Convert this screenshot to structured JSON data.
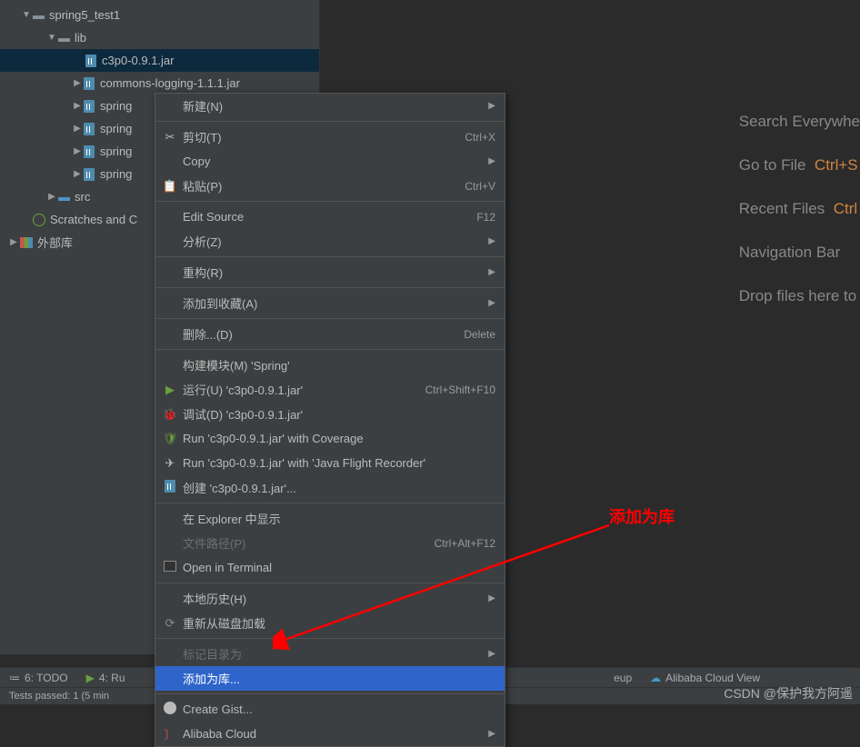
{
  "tree": {
    "project": "spring5_test1",
    "lib": "lib",
    "jars": [
      "c3p0-0.9.1.jar",
      "commons-logging-1.1.1.jar",
      "spring",
      "spring",
      "spring",
      "spring"
    ],
    "src": "src",
    "scratches": "Scratches and C",
    "ext_lib": "外部库"
  },
  "menu": {
    "new": "新建(N)",
    "cut": "剪切(T)",
    "cut_sc": "Ctrl+X",
    "copy": "Copy",
    "paste": "粘贴(P)",
    "paste_sc": "Ctrl+V",
    "edit_source": "Edit Source",
    "edit_source_sc": "F12",
    "analyze": "分析(Z)",
    "refactor": "重构(R)",
    "favorites": "添加到收藏(A)",
    "delete": "删除...(D)",
    "delete_sc": "Delete",
    "build": "构建模块(M) 'Spring'",
    "run": "运行(U) 'c3p0-0.9.1.jar'",
    "run_sc": "Ctrl+Shift+F10",
    "debug": "调试(D) 'c3p0-0.9.1.jar'",
    "coverage": "Run 'c3p0-0.9.1.jar' with Coverage",
    "jfr": "Run 'c3p0-0.9.1.jar' with 'Java Flight Recorder'",
    "create": "创建 'c3p0-0.9.1.jar'...",
    "explorer": "在 Explorer 中显示",
    "filepath": "文件路径(P)",
    "filepath_sc": "Ctrl+Alt+F12",
    "terminal": "Open in Terminal",
    "history": "本地历史(H)",
    "reload": "重新从磁盘加载",
    "markdir": "标记目录为",
    "addlib": "添加为库...",
    "gist": "Create Gist...",
    "alibaba": "Alibaba Cloud"
  },
  "welcome": {
    "search": "Search Everywhe",
    "goto": "Go to File",
    "goto_sc": "Ctrl+S",
    "recent": "Recent Files",
    "recent_sc": "Ctrl",
    "nav": "Navigation Bar",
    "drop": "Drop files here to"
  },
  "bottom": {
    "todo": "6: TODO",
    "run": "4: Ru",
    "eup": "eup",
    "alibaba": "Alibaba Cloud View"
  },
  "status": "Tests passed: 1 (5 min",
  "annotation": "添加为库",
  "watermark": "CSDN @保护我方阿遥"
}
